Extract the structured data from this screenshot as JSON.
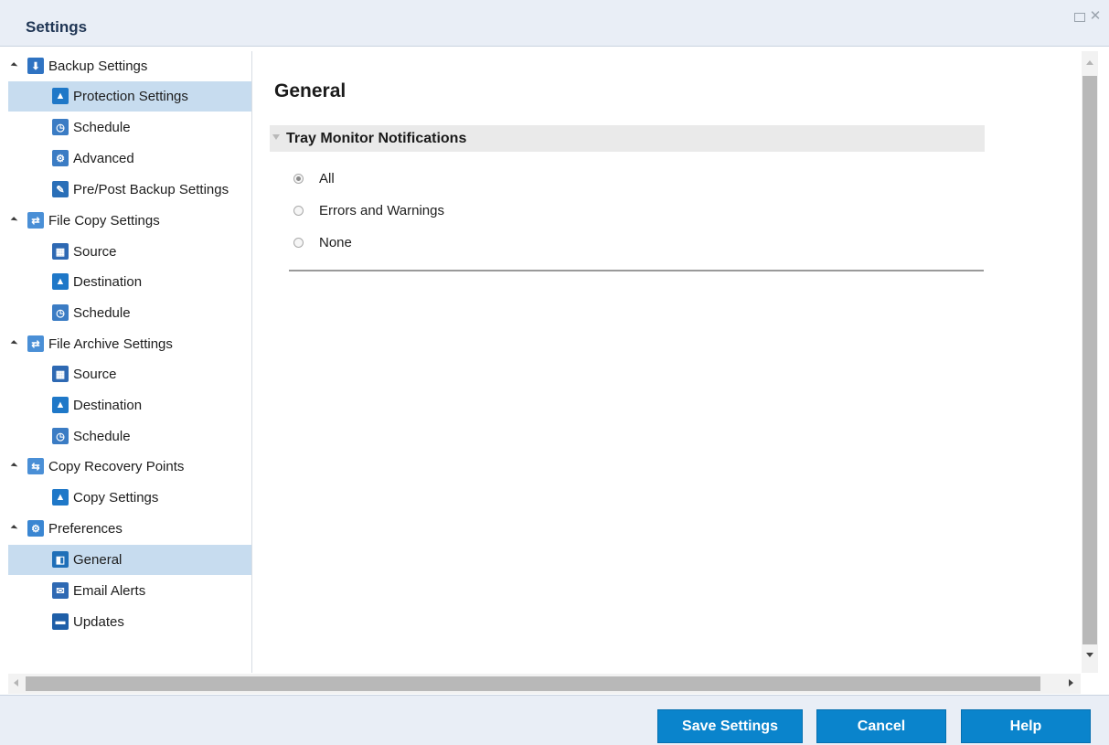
{
  "window": {
    "title": "Settings",
    "restore_icon": "restore-icon",
    "close_glyph": "✕"
  },
  "tree": [
    {
      "label": "Backup Settings",
      "level": 0,
      "icon": "backup-icon",
      "color": "#2f73c2",
      "selected": false
    },
    {
      "label": "Protection Settings",
      "level": 1,
      "icon": "protection-icon",
      "color": "#1f78c8",
      "selected": true
    },
    {
      "label": "Schedule",
      "level": 1,
      "icon": "schedule-icon",
      "color": "#3b7cc4",
      "selected": false
    },
    {
      "label": "Advanced",
      "level": 1,
      "icon": "advanced-icon",
      "color": "#3b7cc4",
      "selected": false
    },
    {
      "label": "Pre/Post Backup Settings",
      "level": 1,
      "icon": "wrench-icon",
      "color": "#2a6fb8",
      "selected": false
    },
    {
      "label": "File Copy Settings",
      "level": 0,
      "icon": "file-copy-icon",
      "color": "#4a8fd6",
      "selected": false
    },
    {
      "label": "Source",
      "level": 1,
      "icon": "source-icon",
      "color": "#2e69b3",
      "selected": false
    },
    {
      "label": "Destination",
      "level": 1,
      "icon": "destination-icon",
      "color": "#1f78c8",
      "selected": false
    },
    {
      "label": "Schedule",
      "level": 1,
      "icon": "schedule-icon",
      "color": "#3b7cc4",
      "selected": false
    },
    {
      "label": "File Archive Settings",
      "level": 0,
      "icon": "file-archive-icon",
      "color": "#4a8fd6",
      "selected": false
    },
    {
      "label": "Source",
      "level": 1,
      "icon": "source-icon",
      "color": "#2e69b3",
      "selected": false
    },
    {
      "label": "Destination",
      "level": 1,
      "icon": "destination-icon",
      "color": "#1f78c8",
      "selected": false
    },
    {
      "label": "Schedule",
      "level": 1,
      "icon": "schedule-icon",
      "color": "#3b7cc4",
      "selected": false
    },
    {
      "label": "Copy Recovery Points",
      "level": 0,
      "icon": "recovery-points-icon",
      "color": "#4a8fd6",
      "selected": false
    },
    {
      "label": "Copy Settings",
      "level": 1,
      "icon": "copy-settings-icon",
      "color": "#1f78c8",
      "selected": false
    },
    {
      "label": "Preferences",
      "level": 0,
      "icon": "preferences-icon",
      "color": "#3a86d2",
      "selected": false
    },
    {
      "label": "General",
      "level": 1,
      "icon": "general-icon",
      "color": "#1f6fb8",
      "selected": true
    },
    {
      "label": "Email Alerts",
      "level": 1,
      "icon": "email-icon",
      "color": "#2e69b3",
      "selected": false
    },
    {
      "label": "Updates",
      "level": 1,
      "icon": "updates-icon",
      "color": "#1f5fa8",
      "selected": false
    }
  ],
  "main": {
    "heading": "General",
    "section_title": "Tray Monitor Notifications",
    "options": [
      {
        "label": "All",
        "checked": true
      },
      {
        "label": "Errors and Warnings",
        "checked": false
      },
      {
        "label": "None",
        "checked": false
      }
    ]
  },
  "footer": {
    "save_label": "Save Settings",
    "cancel_label": "Cancel",
    "help_label": "Help",
    "accent_color": "#0a84cc"
  }
}
